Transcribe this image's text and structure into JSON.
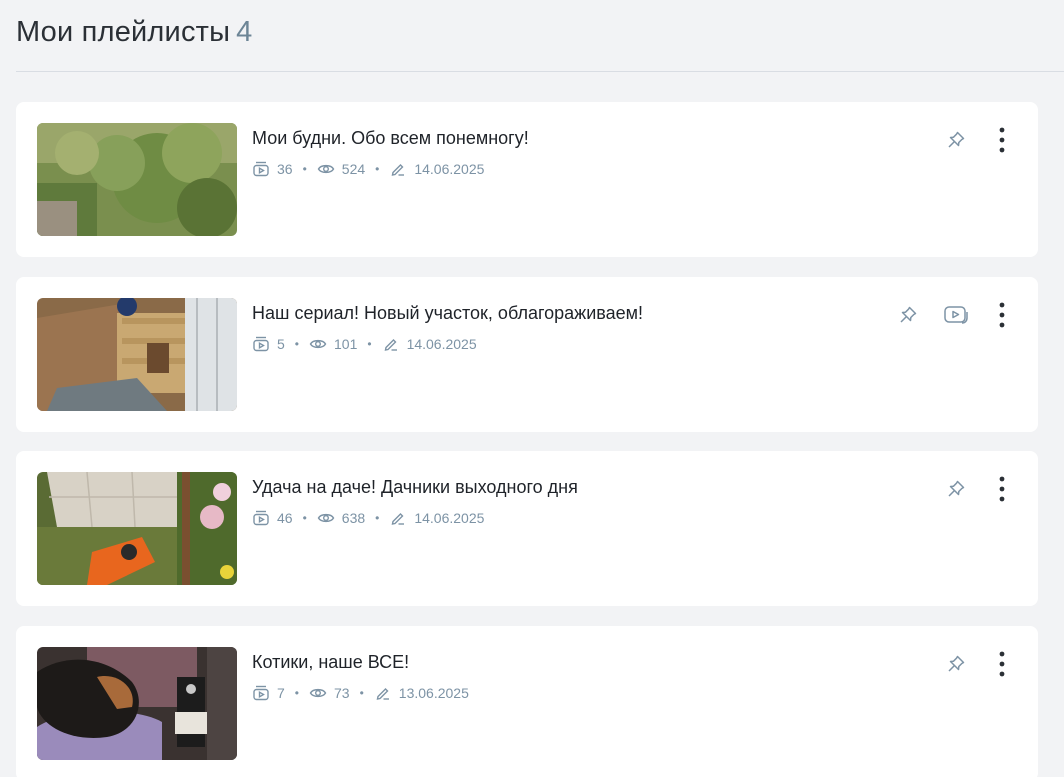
{
  "header": {
    "title": "Мои плейлисты",
    "count": "4"
  },
  "playlists": [
    {
      "title": "Мои будни. Обо всем понемногу!",
      "videos": "36",
      "views": "524",
      "date": "14.06.2025",
      "has_video_icon": false
    },
    {
      "title": "Наш сериал! Новый участок, облагораживаем!",
      "videos": "5",
      "views": "101",
      "date": "14.06.2025",
      "has_video_icon": true
    },
    {
      "title": "Удача на даче! Дачники выходного дня",
      "videos": "46",
      "views": "638",
      "date": "14.06.2025",
      "has_video_icon": false
    },
    {
      "title": "Котики, наше ВСЕ!",
      "videos": "7",
      "views": "73",
      "date": "13.06.2025",
      "has_video_icon": false
    }
  ],
  "icons": {
    "videos": "playlist-icon",
    "views": "eye-icon",
    "date": "pencil-icon",
    "pin": "pin-icon",
    "video": "video-icon",
    "more": "more-vertical-icon"
  },
  "colors": {
    "background": "#f2f3f5",
    "card": "#ffffff",
    "meta": "#7d93a5",
    "count": "#6d8596"
  }
}
